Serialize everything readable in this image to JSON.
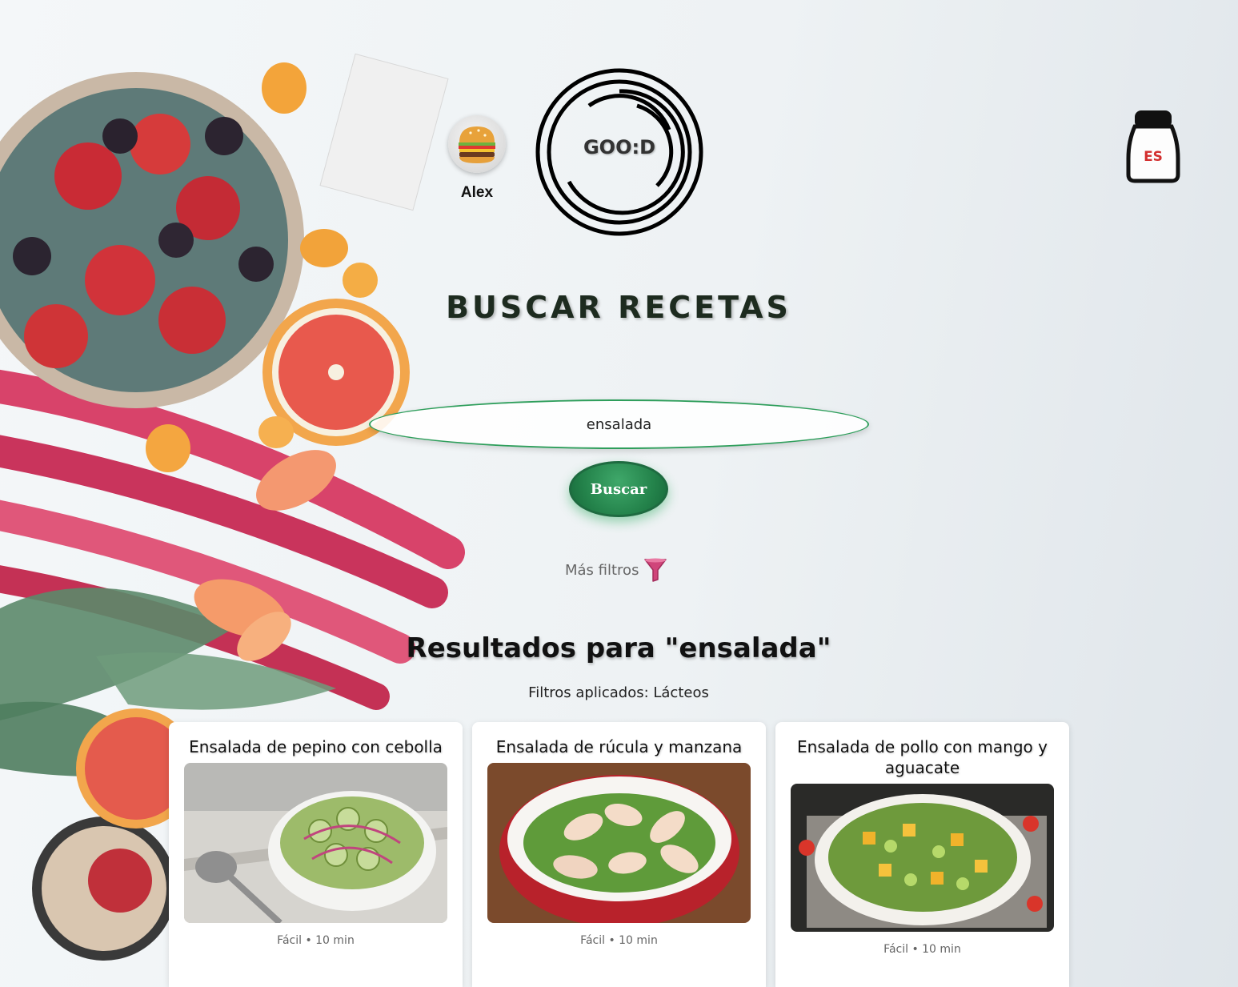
{
  "header": {
    "user_name": "Alex",
    "logo_text": "GOO:D",
    "language": "ES"
  },
  "search": {
    "title": "BUSCAR RECETAS",
    "query": "ensalada",
    "button_label": "Buscar",
    "more_filters_label": "Más filtros"
  },
  "results": {
    "title": "Resultados para \"ensalada\"",
    "filters_applied": "Filtros aplicados: Lácteos",
    "cards": [
      {
        "title": "Ensalada de pepino con cebolla",
        "meta": "Fácil • 10 min"
      },
      {
        "title": "Ensalada de rúcula y manzana",
        "meta": "Fácil • 10 min"
      },
      {
        "title": "Ensalada de pollo con mango y aguacate",
        "meta": "Fácil • 10 min"
      }
    ]
  },
  "icons": {
    "avatar": "burger-icon",
    "language": "salt-shaker-icon",
    "filters": "funnel-icon"
  },
  "colors": {
    "accent": "#24834b",
    "lang": "#d32f2f",
    "funnel": "#d0457a"
  }
}
